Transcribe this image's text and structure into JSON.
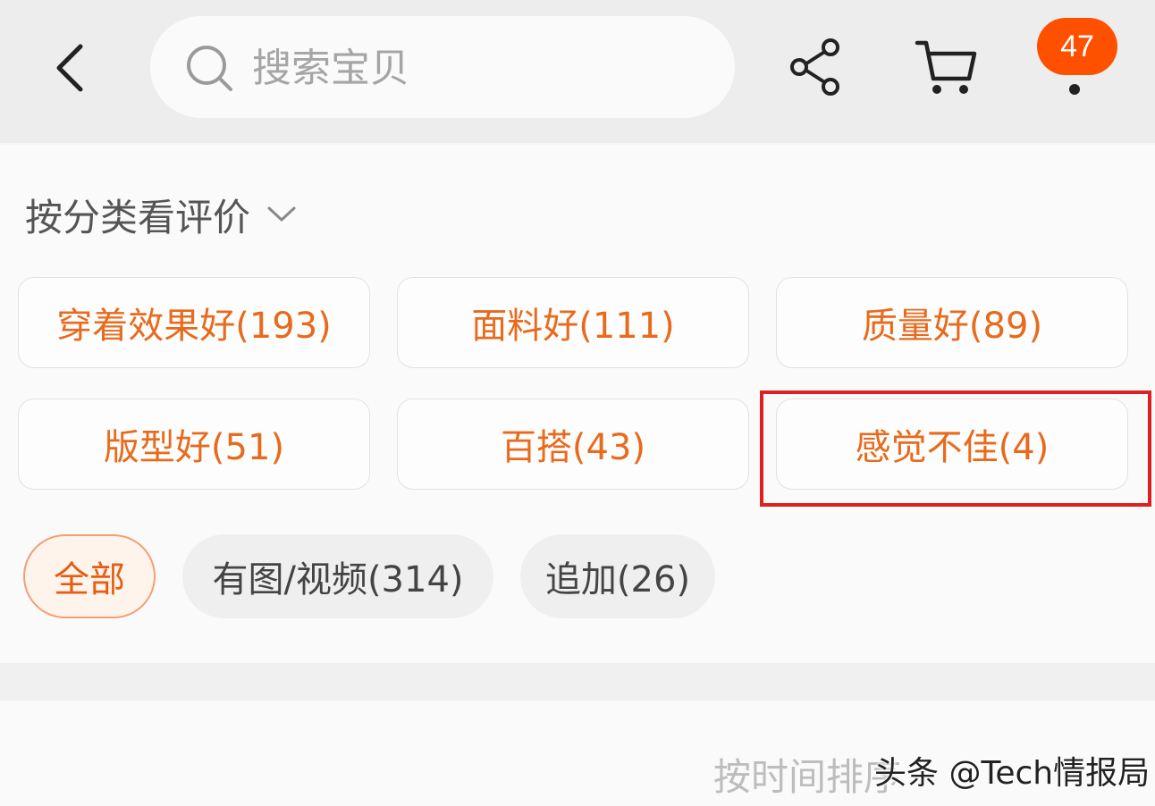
{
  "header": {
    "search_placeholder": "搜索宝贝",
    "message_count": "47",
    "icons": [
      "chevron-left-icon",
      "search-icon",
      "share-icon",
      "cart-icon"
    ]
  },
  "reviews": {
    "section_title": "按分类看评价",
    "tags": [
      {
        "label": "穿着效果好(193)"
      },
      {
        "label": "面料好(111)"
      },
      {
        "label": "质量好(89)"
      },
      {
        "label": "版型好(51)"
      },
      {
        "label": "百搭(43)"
      },
      {
        "label": "感觉不佳(4)",
        "highlighted": true
      }
    ],
    "filters": [
      {
        "label": "全部",
        "active": true
      },
      {
        "label": "有图/视频(314)",
        "active": false
      },
      {
        "label": "追加(26)",
        "active": false
      }
    ]
  },
  "sort": {
    "text": "按时间排序"
  },
  "watermark": "头条 @Tech情报局",
  "colors": {
    "accent": "#ff5000",
    "tag_text": "#e86a1c",
    "highlight_border": "#e02020"
  }
}
